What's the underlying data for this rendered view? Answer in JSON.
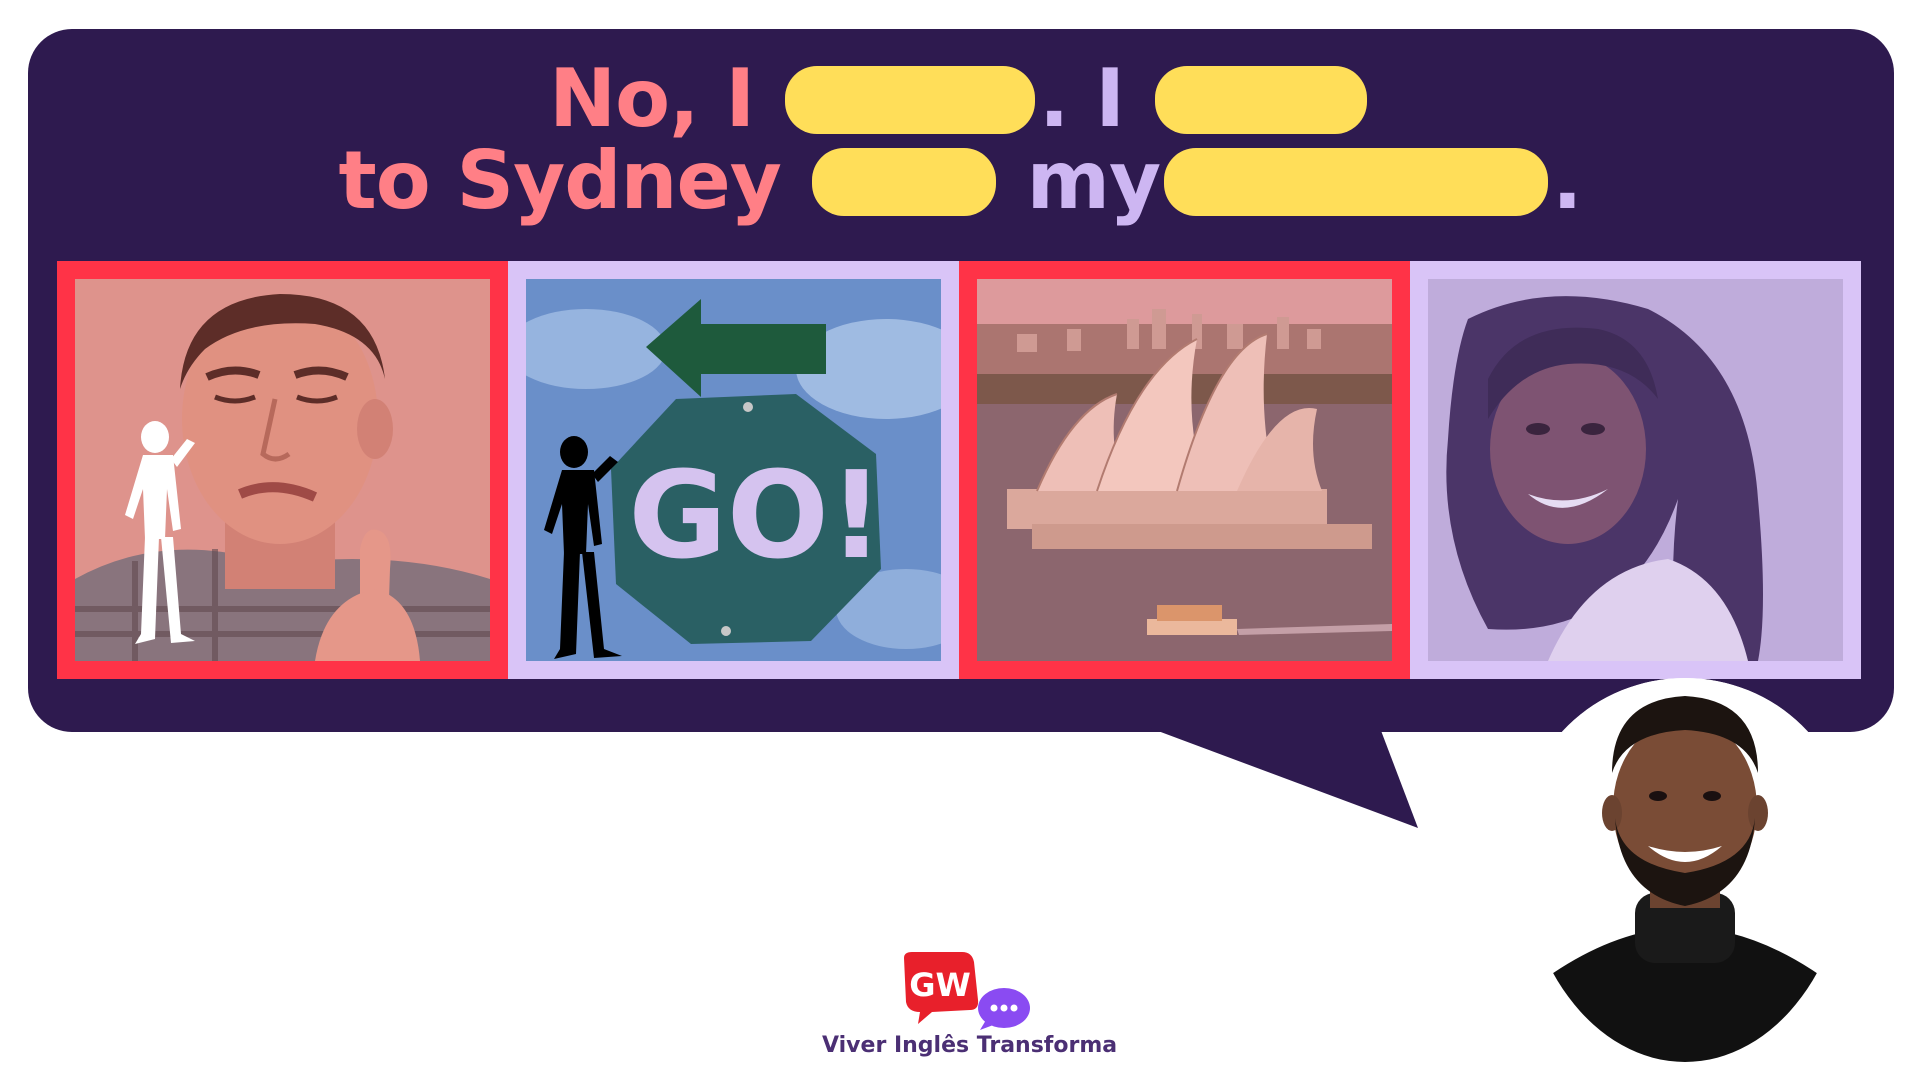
{
  "colors": {
    "bubble": "#2e1a4f",
    "text_pink": "#ff7f86",
    "text_lavender": "#cdb6f2",
    "blank": "#ffde59",
    "panel_red": "#ff3347",
    "panel_lilac": "#d9c4f7",
    "logo_red": "#e8202b",
    "logo_purple": "#8a4bf2",
    "logo_text": "#4b2f74"
  },
  "sentence": {
    "line1": {
      "part1": "No, I",
      "part2": ". I"
    },
    "line2": {
      "part1": "to Sydney",
      "part2": "my",
      "part3": "."
    }
  },
  "panels": [
    {
      "scene": "man-refusing-gesture",
      "icon": "man-silhouette-white-icon",
      "border": "red"
    },
    {
      "scene": "go-sign-arrow",
      "sign_text": "GO!",
      "icon": "man-silhouette-black-icon",
      "border": "lilac"
    },
    {
      "scene": "sydney-opera-house",
      "border": "red"
    },
    {
      "scene": "smiling-woman",
      "border": "lilac"
    }
  ],
  "speaker": {
    "icon": "smiling-man-avatar"
  },
  "logo": {
    "mark": "GW",
    "tagline": "Viver Inglês Transforma"
  }
}
